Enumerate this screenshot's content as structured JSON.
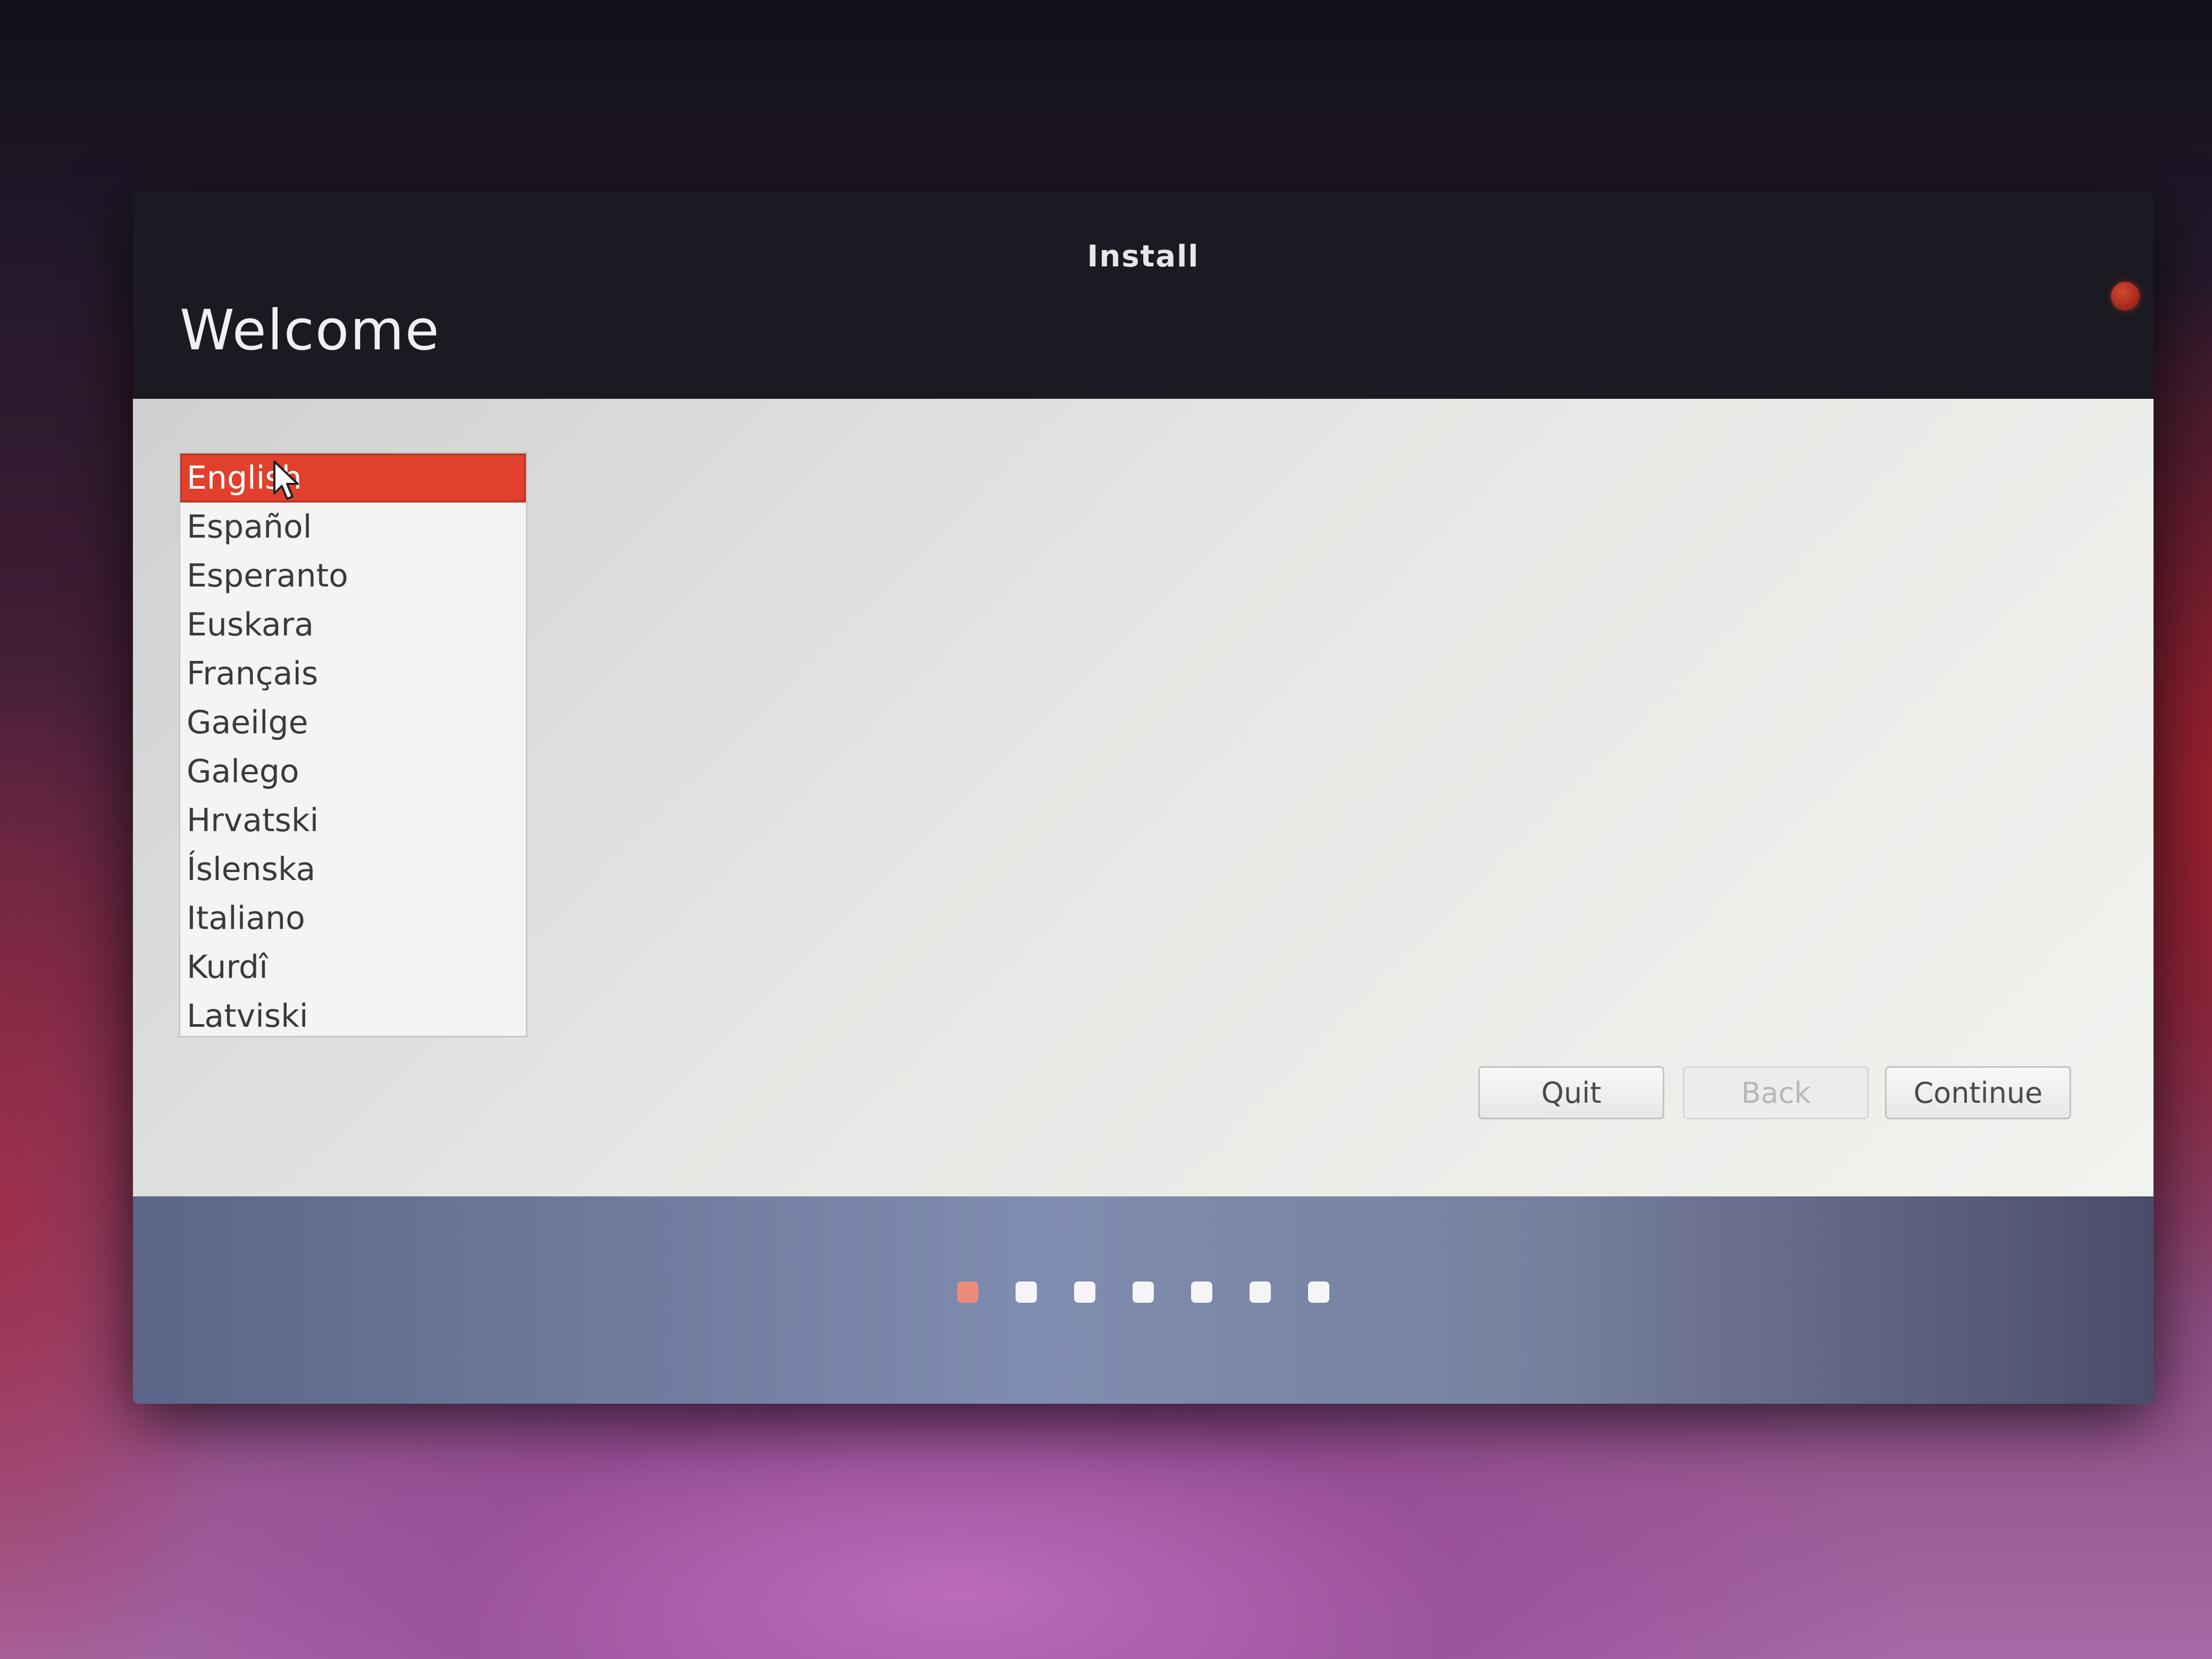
{
  "window": {
    "title": "Install",
    "heading": "Welcome"
  },
  "languages": [
    {
      "label": "English",
      "selected": true
    },
    {
      "label": "Español"
    },
    {
      "label": "Esperanto"
    },
    {
      "label": "Euskara"
    },
    {
      "label": "Français"
    },
    {
      "label": "Gaeilge"
    },
    {
      "label": "Galego"
    },
    {
      "label": "Hrvatski"
    },
    {
      "label": "Íslenska"
    },
    {
      "label": "Italiano"
    },
    {
      "label": "Kurdî"
    },
    {
      "label": "Latviski"
    }
  ],
  "buttons": {
    "quit": "Quit",
    "back": "Back",
    "continue": "Continue"
  },
  "progress": {
    "total_steps": 7,
    "current_step": 1
  },
  "colors": {
    "selection": "#e0402c",
    "active_dot": "#e98c7b"
  }
}
